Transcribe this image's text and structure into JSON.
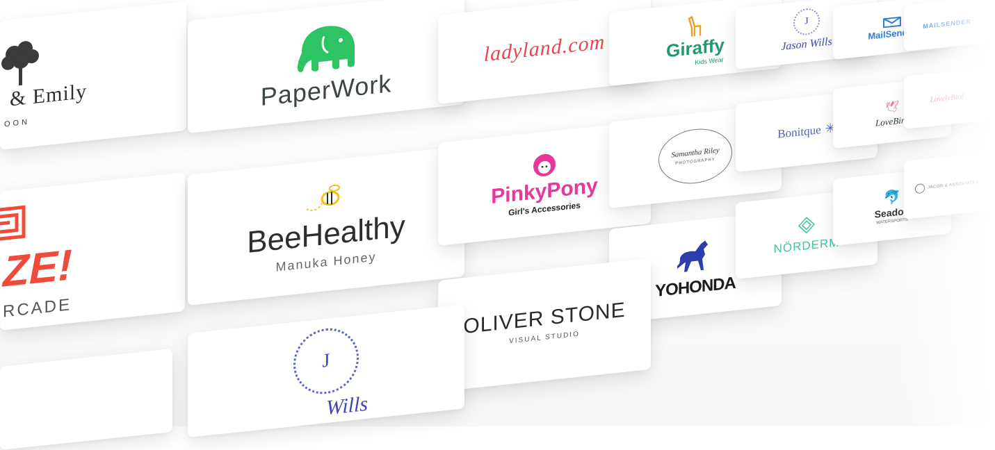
{
  "logos": {
    "emily": {
      "name": "& Emily",
      "tagline": "OON"
    },
    "paperwork": {
      "name": "PaperWork"
    },
    "ladyland": {
      "name": "ladyland.com"
    },
    "giraffy": {
      "name": "Giraffy",
      "tagline": "Kids Wear"
    },
    "jasonwills_top": {
      "initial": "J",
      "name": "Jason Wills"
    },
    "mailsender": {
      "name": "MailSender"
    },
    "mailsender2": {
      "name": "MAILSENDER"
    },
    "maze": {
      "name": "ZE!",
      "tagline": "RCADE"
    },
    "beehealthy": {
      "name": "BeeHealthy",
      "tagline": "Manuka Honey"
    },
    "pinkypony": {
      "name": "PinkyPony",
      "tagline": "Girl's Accessories"
    },
    "samantha": {
      "name": "Samantha Riley",
      "tagline": "PHOTOGRAPHY"
    },
    "bonitque": {
      "name": "Bonitque"
    },
    "lovebird": {
      "name": "LoveBird"
    },
    "lovelybird": {
      "name": "LovelyBird"
    },
    "yohonda": {
      "name": "YOHONDA"
    },
    "norderm": {
      "name": "NÖRDERM"
    },
    "seadoo": {
      "name": "Seadoo",
      "tagline": "WATERSPORTS"
    },
    "jacob": {
      "name": "JACOB & ASSOCIATES"
    },
    "oliver": {
      "name": "OLIVER STONE",
      "tagline": "VISUAL STUDIO"
    },
    "jasonwills_bottom": {
      "initial": "J",
      "name": "Wills"
    }
  },
  "colors": {
    "paperwork_green": "#2dc463",
    "ladyland_red": "#e8454f",
    "giraffy_green": "#1f9a6b",
    "giraffy_orange": "#e8a22b",
    "jason_blue": "#3d47b6",
    "mail_blue": "#2f7fd6",
    "maze_red": "#f04b3a",
    "bee_yellow": "#f2c11a",
    "pinky_pink": "#e8379b",
    "bonitque_blue": "#5564b8",
    "lovelybird_pink": "#f07ba0",
    "yohonda_blue": "#2c3fa8",
    "norderm_teal": "#45c1a6",
    "seadoo_blue": "#3ea8df"
  }
}
